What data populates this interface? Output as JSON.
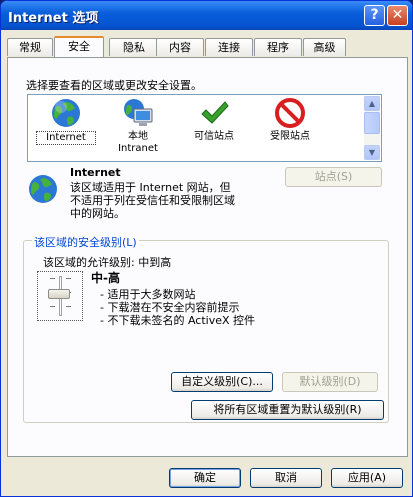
{
  "window": {
    "title": "Internet 选项"
  },
  "titlebar": {
    "help_label": "?",
    "close_label": "✕"
  },
  "tabs": [
    {
      "label": "常规"
    },
    {
      "label": "安全"
    },
    {
      "label": "隐私"
    },
    {
      "label": "内容"
    },
    {
      "label": "连接"
    },
    {
      "label": "程序"
    },
    {
      "label": "高级"
    }
  ],
  "active_tab": "安全",
  "zones": {
    "prompt": "选择要查看的区域或更改安全设置。",
    "items": [
      {
        "label": "Internet",
        "icon": "globe-icon"
      },
      {
        "label": "本地\nIntranet",
        "icon": "computer-icon"
      },
      {
        "label": "可信站点",
        "icon": "checkmark-icon"
      },
      {
        "label": "受限站点",
        "icon": "restricted-icon"
      }
    ],
    "selected": "Internet"
  },
  "zone_info": {
    "name": "Internet",
    "description_line1": "该区域适用于 Internet 网站，但",
    "description_line2": "不适用于列在受信任和受限制区域",
    "description_line3": "中的网站。",
    "sites_button": "站点(S)"
  },
  "security_level": {
    "group_title": "该区域的安全级别(L)",
    "allowed_label": "该区域的允许级别: 中到高",
    "level_name": "中-高",
    "bullets": [
      "- 适用于大多数网站",
      "- 下载潜在不安全内容前提示",
      "- 不下载未签名的 ActiveX 控件"
    ],
    "custom_button": "自定义级别(C)...",
    "default_button": "默认级别(D)",
    "reset_all_button": "将所有区域重置为默认级别(R)"
  },
  "footer": {
    "ok_label": "确定",
    "cancel_label": "取消",
    "apply_label": "应用(A)"
  }
}
